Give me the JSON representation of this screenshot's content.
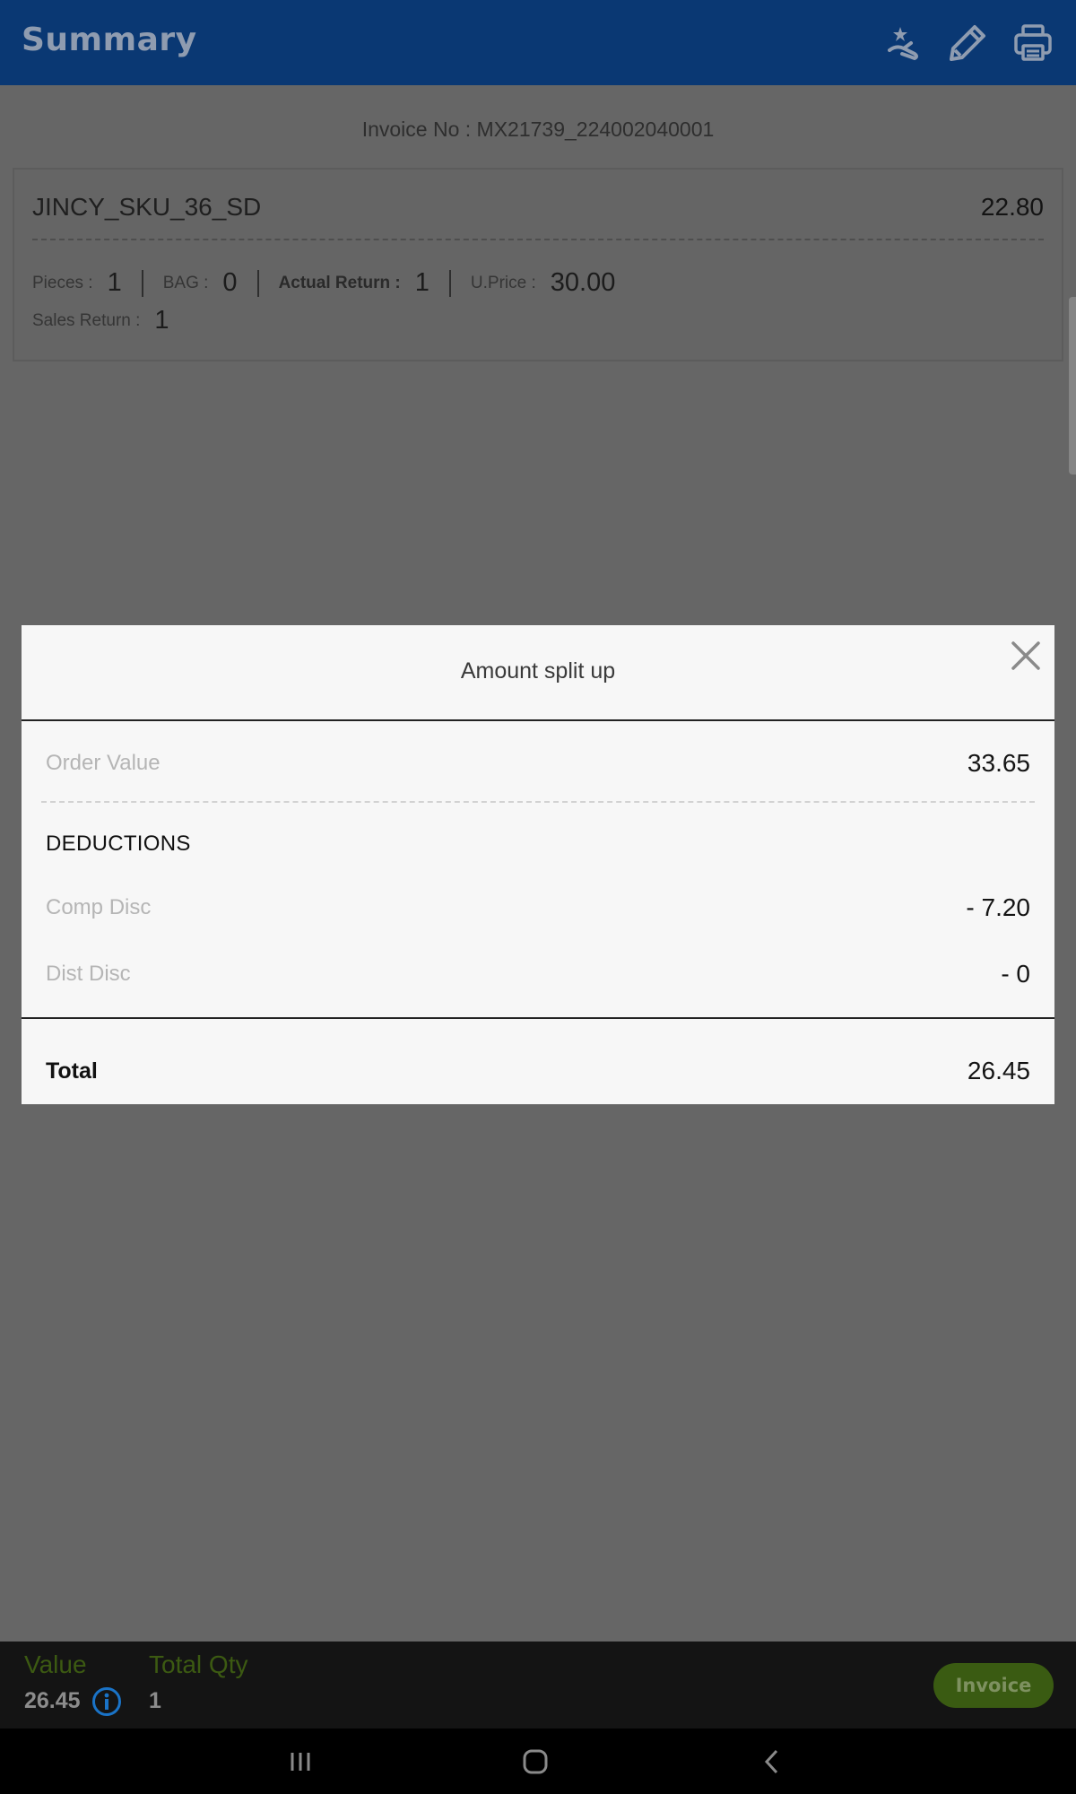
{
  "appbar": {
    "title": "Summary",
    "icons": [
      "scheme-icon",
      "edit-icon",
      "print-icon"
    ]
  },
  "invoice": {
    "label": "Invoice No : MX21739_224002040001"
  },
  "sku": {
    "name": "JINCY_SKU_36_SD",
    "amount": "22.80",
    "pieces_label": "Pieces :",
    "pieces_value": "1",
    "bag_label": "BAG :",
    "bag_value": "0",
    "actual_return_label": "Actual Return :",
    "actual_return_value": "1",
    "uprice_label": "U.Price :",
    "uprice_value": "30.00",
    "sales_return_label": "Sales Return :",
    "sales_return_value": "1"
  },
  "modal": {
    "title": "Amount split up",
    "order_value_label": "Order Value",
    "order_value": "33.65",
    "deductions_heading": "DEDUCTIONS",
    "comp_disc_label": "Comp Disc",
    "comp_disc_value": "- 7.20",
    "dist_disc_label": "Dist Disc",
    "dist_disc_value": "- 0",
    "total_label": "Total",
    "total_value": "26.45"
  },
  "bottombar": {
    "value_label": "Value",
    "value": "26.45",
    "total_qty_label": "Total Qty",
    "total_qty": "1",
    "invoice_button": "Invoice"
  },
  "colors": {
    "appbar": "#0a3873",
    "accent_green": "#3a5b12",
    "info_blue": "#1a73c7"
  }
}
